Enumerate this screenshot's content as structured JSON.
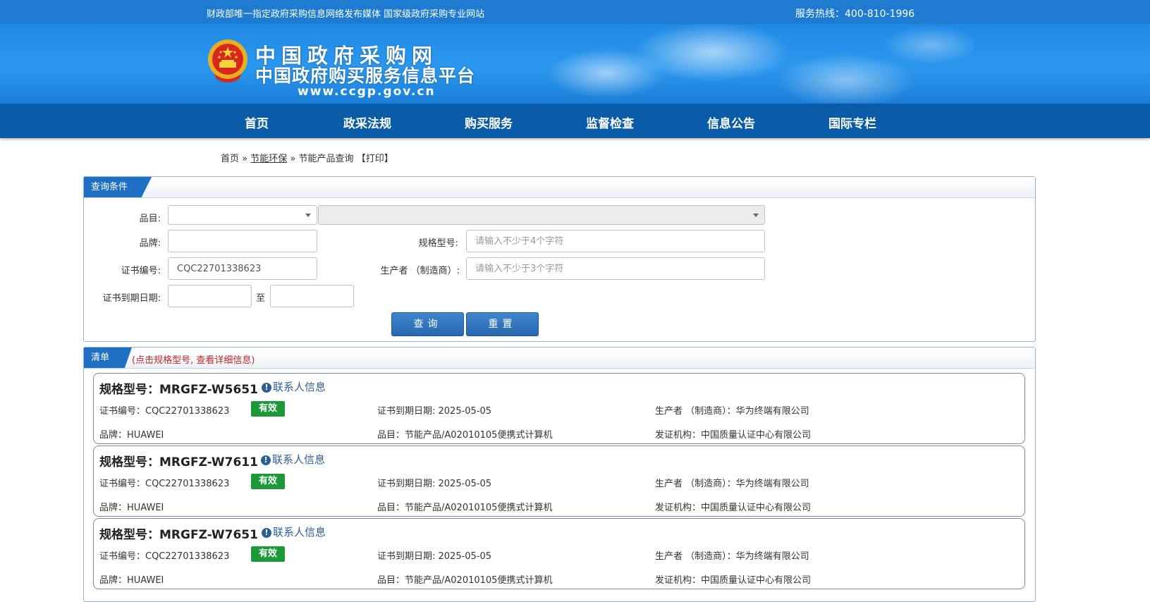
{
  "topbar": {
    "slogan": "财政部唯一指定政府采购信息网络发布媒体 国家级政府采购专业网站",
    "hotline": "服务热线：400-810-1996"
  },
  "header": {
    "logo_line1": "中国政府采购网",
    "logo_line2": "中国政府购买服务信息平台",
    "logo_url": "www.ccgp.gov.cn",
    "emblem": "national-emblem-icon"
  },
  "nav": [
    "首页",
    "政采法规",
    "购买服务",
    "监督检查",
    "信息公告",
    "国际专栏"
  ],
  "breadcrumb": {
    "home": "首页",
    "sep1": "»",
    "section": "节能环保",
    "sep2": "»",
    "page": "节能产品查询",
    "print": "【打印】"
  },
  "query": {
    "title": "查询条件",
    "category_label": "品目:",
    "category_value": "",
    "subcategory_value": "",
    "brand_label": "品牌:",
    "brand_value": "",
    "model_label": "规格型号:",
    "model_placeholder": "请输入不少于4个字符",
    "cert_label": "证书编号:",
    "cert_value": "CQC22701338623",
    "maker_label": "生产者 （制造商）:",
    "maker_placeholder": "请输入不少于3个字符",
    "expiry_label": "证书到期日期:",
    "expiry_from": "",
    "expiry_sep": "至",
    "expiry_to": "",
    "search_button": "查询",
    "reset_button": "重置"
  },
  "list": {
    "title": "清单",
    "note": "(点击规格型号, 查看详细信息)",
    "contact_label": "联系人信息",
    "items": [
      {
        "model": "规格型号：MRGFZ-W5651",
        "cert": "证书编号：CQC22701338623",
        "status": "有效",
        "expiry": "证书到期日期: 2025-05-05",
        "maker": "生产者 （制造商）：华为终端有限公司",
        "brand": "品牌：HUAWEI",
        "category": "品目：节能产品/A02010105便携式计算机",
        "issuer": "发证机构：中国质量认证中心有限公司"
      },
      {
        "model": "规格型号：MRGFZ-W7611",
        "cert": "证书编号：CQC22701338623",
        "status": "有效",
        "expiry": "证书到期日期: 2025-05-05",
        "maker": "生产者 （制造商）：华为终端有限公司",
        "brand": "品牌：HUAWEI",
        "category": "品目：节能产品/A02010105便携式计算机",
        "issuer": "发证机构：中国质量认证中心有限公司"
      },
      {
        "model": "规格型号：MRGFZ-W7651",
        "cert": "证书编号：CQC22701338623",
        "status": "有效",
        "expiry": "证书到期日期: 2025-05-05",
        "maker": "生产者 （制造商）：华为终端有限公司",
        "brand": "品牌：HUAWEI",
        "category": "品目：节能产品/A02010105便携式计算机",
        "issuer": "发证机构：中国质量认证中心有限公司"
      }
    ]
  },
  "colors": {
    "topbar": "#1e7bd0",
    "nav": "#0b5ca8",
    "panel_tab": "#1f6fc5",
    "badge": "#1c9a3a",
    "note": "#c0262c"
  }
}
